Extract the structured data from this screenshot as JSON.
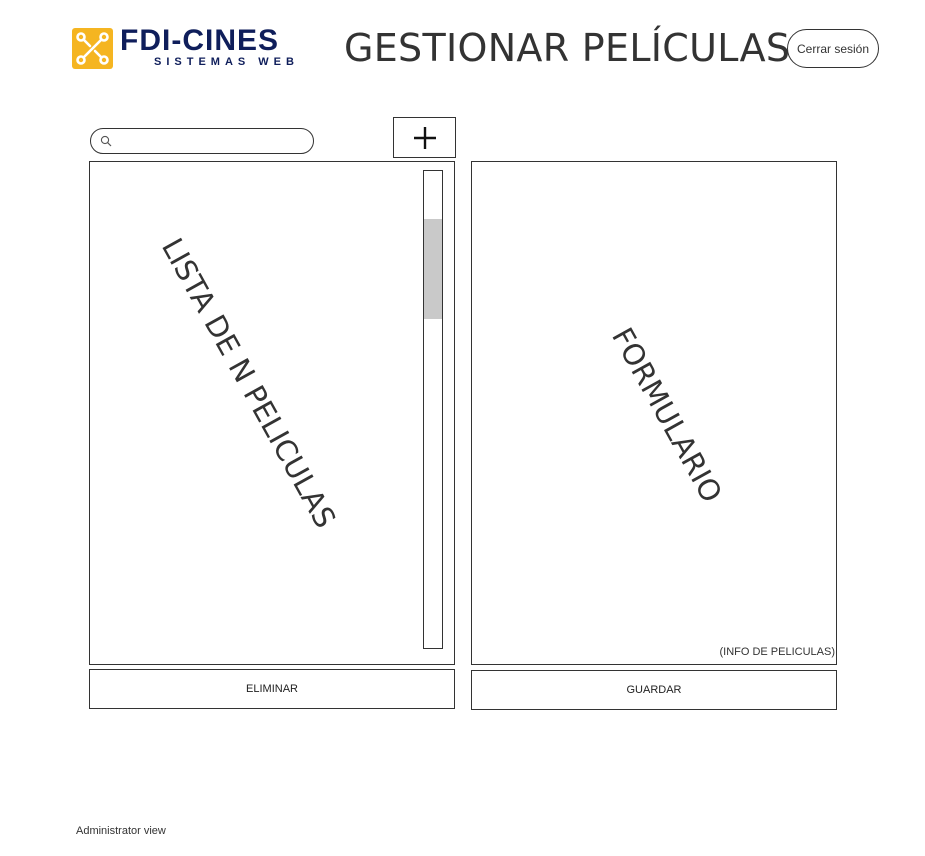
{
  "header": {
    "logo_name": "FDI-CINES",
    "logo_subtitle": "SISTEMAS WEB",
    "title": "GESTIONAR PELÍCULAS",
    "logout_label": "Cerrar sesión"
  },
  "toolbar": {
    "search_placeholder": "",
    "add_label": "+"
  },
  "list_panel": {
    "label": "LISTA DE N PELICULAS",
    "delete_label": "ELIMINAR"
  },
  "form_panel": {
    "label": "FORMULARIO",
    "note": "(INFO DE PELICULAS)",
    "save_label": "GUARDAR"
  },
  "footer": {
    "view_label": "Administrator view"
  },
  "icons": {
    "logo": "circuit-icon",
    "search": "search-icon",
    "add": "plus-icon"
  },
  "colors": {
    "brand_yellow": "#f5b521",
    "brand_navy": "#0f1e5b",
    "scroll_thumb": "#c9c9c9"
  }
}
